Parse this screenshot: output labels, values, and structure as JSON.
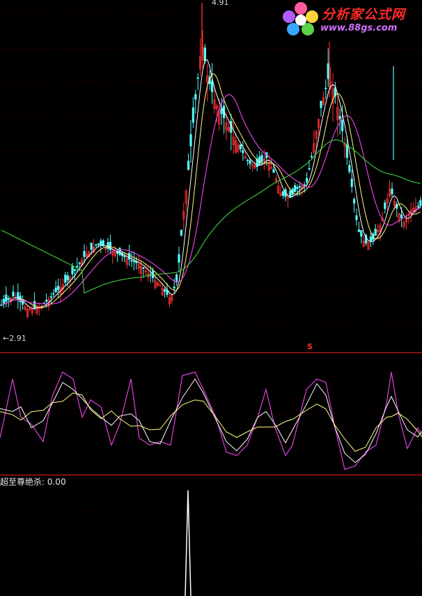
{
  "chart": {
    "price_high_label": "4.91",
    "price_low_label": "←2.91",
    "signal_marker": "S",
    "indicator_name": "超至尊绝杀",
    "indicator_value": "0.00",
    "indicator_readout": "超至尊绝杀: 0.00"
  },
  "logo": {
    "title": "分析家公式网",
    "url": "www.88gs.com"
  },
  "colors": {
    "background": "#000000",
    "up_candle": "#ff3030",
    "down_candle": "#54ffff",
    "ma_white": "#ffffff",
    "ma_yellow": "#ffff80",
    "ma_magenta": "#e040e0",
    "ma_green": "#40d040",
    "grid": "#ff0000",
    "separator": "#ff2020"
  }
}
